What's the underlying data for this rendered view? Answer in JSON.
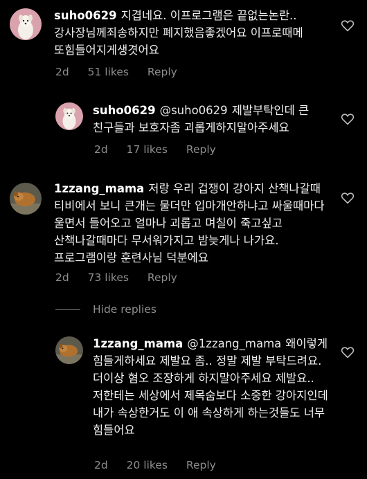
{
  "comments": [
    {
      "username": "suho0629",
      "text": "지겹네요. 이프로그램은 끝없는논란.. 강사장님께죄송하지만 폐지했음좋겠어요 이프로때메 또힘들어지게생겻어요",
      "age": "2d",
      "likes": "51 likes",
      "reply": "Reply"
    },
    {
      "username": "suho0629",
      "mention": "@suho0629",
      "text": "제발부탁인데 큰 친구들과 보호자좀 괴롭게하지말아주세요",
      "age": "2d",
      "likes": "17 likes",
      "reply": "Reply"
    },
    {
      "username": "1zzang_mama",
      "text": "저랑 우리 겁쟁이 강아지 산책나갈때 티비에서 보니 큰개는 물더만 입마개안하냐고 싸울때마다 울면서 들어오고 얼마나 괴롭고 며칠이 죽고싶고 산책나갈때마다 무서워가지고 밤늦게나 나가요. 프로그램이랑 훈련사님 덕분에요",
      "age": "2d",
      "likes": "73 likes",
      "reply": "Reply"
    },
    {
      "username": "1zzang_mama",
      "mention": "@1zzang_mama",
      "text": "왜이렇게 힘들게하세요 제발요 좀.. 정말 제발 부탁드려요. 더이상 혐오 조장하게 하지말아주세요 제발요.. 저한테는 세상에서 제목숨보다 소중한 강아지인데 내가 속상한거도 이 애 속상하게 하는것들도 너무 힘들어요",
      "age": "2d",
      "likes": "20 likes",
      "reply": "Reply"
    }
  ],
  "hide_replies": "Hide replies",
  "icons": {
    "like": "heart-outline-icon",
    "avatar_suho": "white-dog-avatar",
    "avatar_mama": "brown-dog-avatar"
  },
  "colors": {
    "background": "#000000",
    "text": "#f0f0f0",
    "muted": "#8e8e8e"
  }
}
